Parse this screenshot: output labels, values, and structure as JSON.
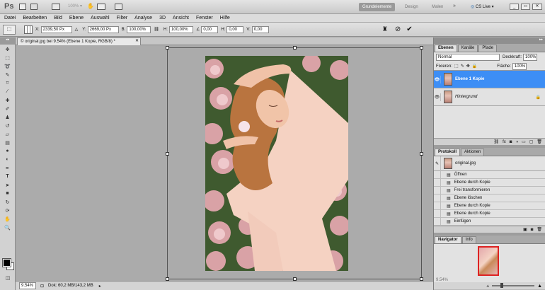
{
  "app": {
    "logo": "Ps",
    "zoom_display": "100%",
    "workspaces": [
      "Grundelemente",
      "Design",
      "Malen"
    ],
    "cs_live": "CS Live"
  },
  "menu": [
    "Datei",
    "Bearbeiten",
    "Bild",
    "Ebene",
    "Auswahl",
    "Filter",
    "Analyse",
    "3D",
    "Ansicht",
    "Fenster",
    "Hilfe"
  ],
  "options": {
    "x_label": "X:",
    "x": "2339,50 Px",
    "y_label": "Y:",
    "y": "2669,00 Px",
    "w_label": "B:",
    "w": "100,00%",
    "h_label": "H:",
    "h": "100,00%",
    "angle": "0,00",
    "hskew_label": "H:",
    "hskew": "0,00",
    "vskew_label": "V:",
    "vskew": "0,00"
  },
  "document": {
    "tab_title": "© original.jpg bei 9.54% (Ebene 1 Kopie, RGB/8) *"
  },
  "status": {
    "zoom": "9.54%",
    "doc": "Dok: 60,2 MB/143,2 MB"
  },
  "layers_panel": {
    "tabs": [
      "Ebenen",
      "Kanäle",
      "Pfade"
    ],
    "blend_mode": "Normal",
    "opacity_label": "Deckkraft:",
    "opacity": "100%",
    "lock_label": "Fixieren:",
    "fill_label": "Fläche:",
    "fill": "100%",
    "layers": [
      {
        "name": "Ebene 1 Kopie",
        "selected": true
      },
      {
        "name": "Hintergrund",
        "selected": false
      }
    ]
  },
  "history_panel": {
    "tabs": [
      "Protokoll",
      "Aktionen"
    ],
    "snapshot": "original.jpg",
    "items": [
      "Öffnen",
      "Ebene durch Kopie",
      "Frei transformieren",
      "Ebene löschen",
      "Ebene durch Kopie",
      "Ebene durch Kopie",
      "Einfügen"
    ]
  },
  "navigator_panel": {
    "tabs": [
      "Navigator",
      "Info"
    ],
    "zoom": "9.54%"
  }
}
